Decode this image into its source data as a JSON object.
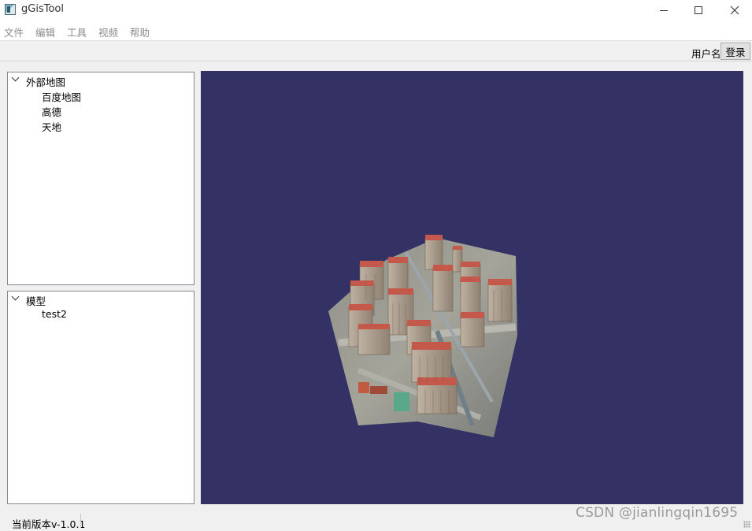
{
  "window": {
    "title": "gGisTool"
  },
  "menu": [
    "文件",
    "编辑",
    "工具",
    "视频",
    "帮助"
  ],
  "toolbar": {
    "username_label": "用户名",
    "login_label": "登录"
  },
  "tree_maps": {
    "root": "外部地图",
    "children": [
      "百度地图",
      "高德",
      "天地"
    ]
  },
  "tree_models": {
    "root": "模型",
    "children": [
      "test2"
    ]
  },
  "viewport": {
    "background": "#343265",
    "content": "3d-city-model"
  },
  "status": {
    "version": "当前版本v-1.0.1"
  },
  "watermark": "CSDN @jianlingqin1695"
}
